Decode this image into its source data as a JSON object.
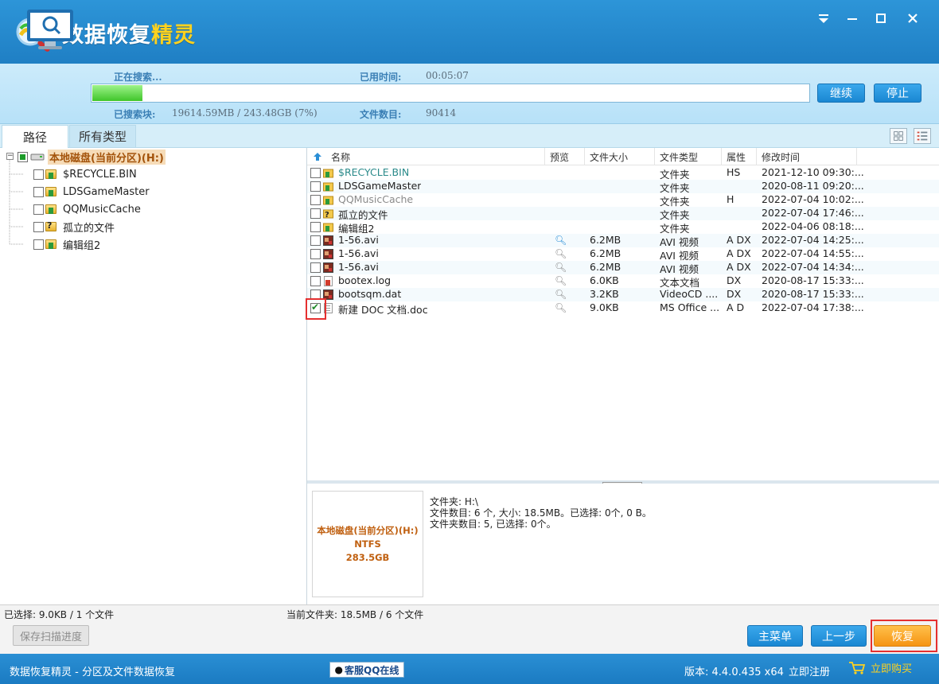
{
  "app": {
    "title_part1": "数据恢复",
    "title_part2": "精灵"
  },
  "scan": {
    "status_label": "正在搜索...",
    "elapsed_label": "已用时间:",
    "elapsed_value": "00:05:07",
    "searched_label": "已搜索块:",
    "searched_value": "19614.59MB / 243.48GB (7%)",
    "file_count_label": "文件数目:",
    "file_count_value": "90414",
    "progress_fraction": 0.07,
    "continue_label": "继续",
    "stop_label": "停止"
  },
  "tabs": [
    {
      "label": "路径"
    },
    {
      "label": "所有类型"
    }
  ],
  "tree": {
    "root_label": "本地磁盘(当前分区)(H:)",
    "items": [
      {
        "label": "$RECYCLE.BIN",
        "icon": "recycle-folder-icon"
      },
      {
        "label": "LDSGameMaster",
        "icon": "recycle-folder-icon"
      },
      {
        "label": "QQMusicCache",
        "icon": "recycle-folder-icon"
      },
      {
        "label": "孤立的文件",
        "icon": "unknown-folder-icon"
      },
      {
        "label": "编辑组2",
        "icon": "recycle-folder-icon"
      }
    ]
  },
  "list": {
    "headers": {
      "name": "名称",
      "preview": "预览",
      "size": "文件大小",
      "type": "文件类型",
      "attr": "属性",
      "mtime": "修改时间"
    },
    "rows": [
      {
        "name": "$RECYCLE.BIN",
        "size": "",
        "type": "文件夹",
        "attr": "HS",
        "mtime": "2021-12-10 09:30:...",
        "icon": "recycle-folder-icon",
        "name_color": "#2a8a8a"
      },
      {
        "name": "LDSGameMaster",
        "size": "",
        "type": "文件夹",
        "attr": "",
        "mtime": "2020-08-11 09:20:...",
        "icon": "recycle-folder-icon",
        "name_color": "#222222"
      },
      {
        "name": "QQMusicCache",
        "size": "",
        "type": "文件夹",
        "attr": "H",
        "mtime": "2022-07-04 10:02:...",
        "icon": "recycle-folder-icon",
        "name_color": "#8a8a8a"
      },
      {
        "name": "孤立的文件",
        "size": "",
        "type": "文件夹",
        "attr": "",
        "mtime": "2022-07-04 17:46:...",
        "icon": "unknown-folder-icon",
        "name_color": "#222222"
      },
      {
        "name": "编辑组2",
        "size": "",
        "type": "文件夹",
        "attr": "",
        "mtime": "2022-04-06 08:18:...",
        "icon": "recycle-folder-icon",
        "name_color": "#222222"
      },
      {
        "name": "1-56.avi",
        "size": "6.2MB",
        "type": "AVI 视频",
        "attr": "A DX",
        "mtime": "2022-07-04 14:25:...",
        "icon": "video-file-icon",
        "name_color": "#222222",
        "preview": true,
        "preview_active": true
      },
      {
        "name": "1-56.avi",
        "size": "6.2MB",
        "type": "AVI 视频",
        "attr": "A DX",
        "mtime": "2022-07-04 14:55:...",
        "icon": "video-file-icon",
        "name_color": "#222222",
        "preview": true
      },
      {
        "name": "1-56.avi",
        "size": "6.2MB",
        "type": "AVI 视频",
        "attr": "A DX",
        "mtime": "2022-07-04 14:34:...",
        "icon": "video-file-icon",
        "name_color": "#222222",
        "preview": true
      },
      {
        "name": "bootex.log",
        "size": "6.0KB",
        "type": "文本文档",
        "attr": "DX",
        "mtime": "2020-08-17 15:33:...",
        "icon": "deleted-text-file-icon",
        "name_color": "#222222",
        "preview": true
      },
      {
        "name": "bootsqm.dat",
        "size": "3.2KB",
        "type": "VideoCD ....",
        "attr": "DX",
        "mtime": "2020-08-17 15:33:...",
        "icon": "video-file-icon",
        "name_color": "#222222",
        "preview": true
      },
      {
        "name": "新建 DOC 文档.doc",
        "size": "9.0KB",
        "type": "MS Office ...",
        "attr": "A D",
        "mtime": "2022-07-04 17:38:...",
        "icon": "doc-file-icon",
        "name_color": "#222222",
        "preview": true,
        "checked": true
      }
    ]
  },
  "detail": {
    "disk_name": "本地磁盘(当前分区)(H:)",
    "fs": "NTFS",
    "capacity": "283.5GB",
    "line1": "文件夹: H:\\",
    "line2": "文件数目: 6 个, 大小: 18.5MB。已选择: 0个, 0 B。",
    "line3": "文件夹数目: 5, 已选择: 0个。"
  },
  "status": {
    "selected": "已选择: 9.0KB / 1 个文件",
    "current_folder": "当前文件夹: 18.5MB / 6 个文件",
    "save_progress_label": "保存扫描进度",
    "main_menu_label": "主菜单",
    "back_label": "上一步",
    "restore_label": "恢复"
  },
  "footer": {
    "caption": "数据恢复精灵 - 分区及文件数据恢复",
    "qq_label": "客服QQ在线",
    "version": "版本: 4.4.0.435 x64",
    "register": "立即注册",
    "buy": "立即购买"
  },
  "colors": {
    "title_blue": "#1f7fc4",
    "accent_orange": "#f59413",
    "progress_green": "#3fc52a",
    "highlight_red": "#e53030"
  }
}
